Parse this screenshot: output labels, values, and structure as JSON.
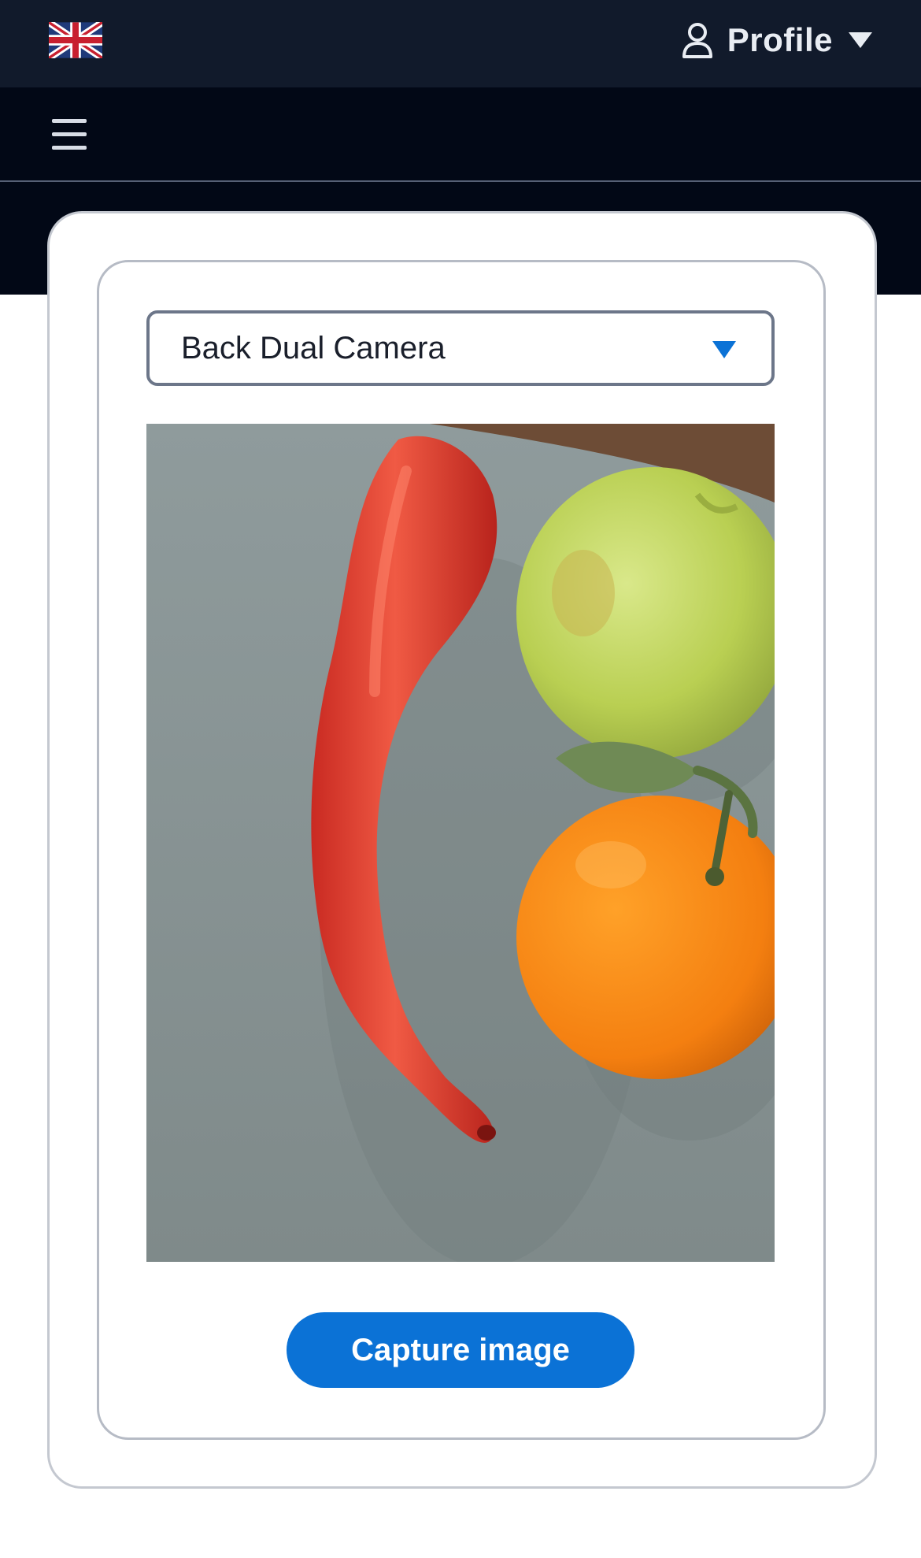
{
  "header": {
    "language_flag_icon": "uk-flag-icon",
    "profile": {
      "label": "Profile",
      "icon": "user-icon",
      "dropdown_icon": "caret-down-icon"
    }
  },
  "navbar": {
    "menu_icon": "hamburger-menu-icon"
  },
  "camera": {
    "selected_device": "Back Dual Camera",
    "dropdown_icon": "caret-down-icon",
    "preview_content": "camera-feed-image",
    "capture_label": "Capture image"
  },
  "colors": {
    "topbar": "#111a2b",
    "navbar": "#020816",
    "accent": "#0b72d6"
  }
}
